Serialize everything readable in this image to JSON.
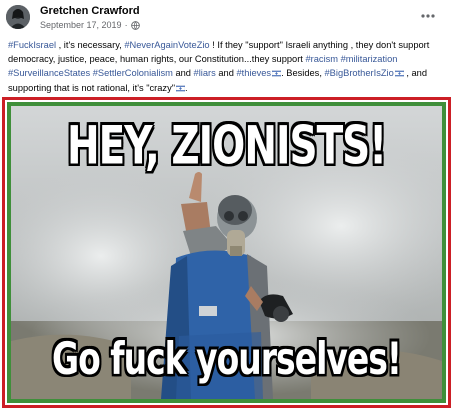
{
  "post": {
    "author": "Gretchen Crawford",
    "date": "September 17, 2019",
    "date_separator": "·",
    "privacy_icon": "globe-icon",
    "more_icon": "more-horizontal-icon"
  },
  "text": {
    "tag_fuckisrael": "#FuckIsrael",
    "seg1": " , it's necessary, ",
    "tag_neveragain": "#NeverAgainVoteZio",
    "seg2": " ! If they \"support\" Israeli anything , they don't support democracy, justice, peace, human rights, our Constitution...they support ",
    "tag_racism": "#racism",
    "seg3": " ",
    "tag_militarization": "#militarization",
    "seg4": " ",
    "tag_surveillance": "#SurveillanceStates",
    "seg5": " ",
    "tag_settler": "#SettlerColonialism",
    "seg6": " and ",
    "tag_liars": "#liars",
    "seg7": " and ",
    "tag_thieves": "#thieves",
    "seg8": ". Besides, ",
    "tag_bigbrother": "#BigBrotherIsZio",
    "seg9": " , and supporting that is not rational, it's \"crazy\"",
    "seg10": "."
  },
  "meme": {
    "top_text": "HEY, ZIONISTS!",
    "bottom_text": "Go fuck yourselves!",
    "border_outer_color": "#cc1f26",
    "border_inner_color": "#3f8f3a"
  },
  "colors": {
    "link": "#385898",
    "secondary_text": "#65676b"
  }
}
